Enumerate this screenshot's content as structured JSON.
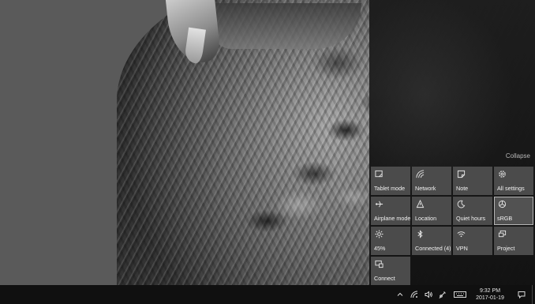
{
  "action_center": {
    "collapse_label": "Collapse",
    "tiles": [
      {
        "label": "Tablet mode",
        "icon": "tablet-mode-icon",
        "highlighted": false
      },
      {
        "label": "Network",
        "icon": "network-icon",
        "highlighted": false
      },
      {
        "label": "Note",
        "icon": "note-icon",
        "highlighted": false
      },
      {
        "label": "All settings",
        "icon": "settings-gear-icon",
        "highlighted": false
      },
      {
        "label": "Airplane mode",
        "icon": "airplane-icon",
        "highlighted": false
      },
      {
        "label": "Location",
        "icon": "location-icon",
        "highlighted": false
      },
      {
        "label": "Quiet hours",
        "icon": "moon-icon",
        "highlighted": false
      },
      {
        "label": "sRGB",
        "icon": "color-profile-icon",
        "highlighted": true
      },
      {
        "label": "45%",
        "icon": "brightness-icon",
        "highlighted": false
      },
      {
        "label": "Connected (4)",
        "icon": "bluetooth-icon",
        "highlighted": false
      },
      {
        "label": "VPN",
        "icon": "vpn-icon",
        "highlighted": false
      },
      {
        "label": "Project",
        "icon": "project-icon",
        "highlighted": false
      },
      {
        "label": "Connect",
        "icon": "connect-icon",
        "highlighted": false
      }
    ]
  },
  "taskbar": {
    "tray_icons": [
      "chevron-up-icon",
      "wifi-icon",
      "volume-icon",
      "pen-icon",
      "keyboard-icon"
    ],
    "time": "9:32 PM",
    "date": "2017-01-19",
    "notification_icon": "notification-icon"
  },
  "colors": {
    "tile_bg": "#4b4b4b",
    "panel_bg": "#161616",
    "taskbar_bg": "#101010"
  }
}
